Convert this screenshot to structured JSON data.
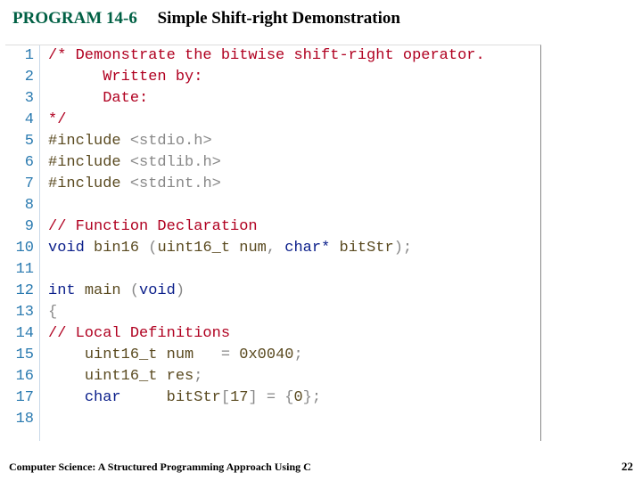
{
  "header": {
    "program_label": "PROGRAM 14-6",
    "title": "Simple Shift-right Demonstration"
  },
  "code": {
    "lines": [
      {
        "n": "1",
        "seg": [
          {
            "c": "comment",
            "t": "/* Demonstrate the bitwise shift-right operator."
          }
        ]
      },
      {
        "n": "2",
        "seg": [
          {
            "c": "comment",
            "t": "      Written by:"
          }
        ]
      },
      {
        "n": "3",
        "seg": [
          {
            "c": "comment",
            "t": "      Date:"
          }
        ]
      },
      {
        "n": "4",
        "seg": [
          {
            "c": "comment",
            "t": "*/"
          }
        ]
      },
      {
        "n": "5",
        "seg": [
          {
            "c": "pp",
            "t": "#include"
          },
          {
            "c": "",
            "t": " "
          },
          {
            "c": "angle",
            "t": "<stdio.h>"
          }
        ]
      },
      {
        "n": "6",
        "seg": [
          {
            "c": "pp",
            "t": "#include"
          },
          {
            "c": "",
            "t": " "
          },
          {
            "c": "angle",
            "t": "<stdlib.h>"
          }
        ]
      },
      {
        "n": "7",
        "seg": [
          {
            "c": "pp",
            "t": "#include"
          },
          {
            "c": "",
            "t": " "
          },
          {
            "c": "angle",
            "t": "<stdint.h>"
          }
        ]
      },
      {
        "n": "8",
        "seg": [
          {
            "c": "",
            "t": ""
          }
        ]
      },
      {
        "n": "9",
        "seg": [
          {
            "c": "comment",
            "t": "// Function Declaration"
          }
        ]
      },
      {
        "n": "10",
        "seg": [
          {
            "c": "key",
            "t": "void"
          },
          {
            "c": "",
            "t": " "
          },
          {
            "c": "id",
            "t": "bin16"
          },
          {
            "c": "",
            "t": " "
          },
          {
            "c": "punc",
            "t": "("
          },
          {
            "c": "id",
            "t": "uint16_t"
          },
          {
            "c": "",
            "t": " "
          },
          {
            "c": "id",
            "t": "num"
          },
          {
            "c": "punc",
            "t": ","
          },
          {
            "c": "",
            "t": " "
          },
          {
            "c": "key",
            "t": "char*"
          },
          {
            "c": "",
            "t": " "
          },
          {
            "c": "id",
            "t": "bitStr"
          },
          {
            "c": "punc",
            "t": ");"
          }
        ]
      },
      {
        "n": "11",
        "seg": [
          {
            "c": "",
            "t": ""
          }
        ]
      },
      {
        "n": "12",
        "seg": [
          {
            "c": "key",
            "t": "int"
          },
          {
            "c": "",
            "t": " "
          },
          {
            "c": "id",
            "t": "main"
          },
          {
            "c": "",
            "t": " "
          },
          {
            "c": "punc",
            "t": "("
          },
          {
            "c": "key",
            "t": "void"
          },
          {
            "c": "punc",
            "t": ")"
          }
        ]
      },
      {
        "n": "13",
        "seg": [
          {
            "c": "punc",
            "t": "{"
          }
        ]
      },
      {
        "n": "14",
        "seg": [
          {
            "c": "comment",
            "t": "// Local Definitions"
          }
        ]
      },
      {
        "n": "15",
        "seg": [
          {
            "c": "",
            "t": "    "
          },
          {
            "c": "id",
            "t": "uint16_t"
          },
          {
            "c": "",
            "t": " "
          },
          {
            "c": "id",
            "t": "num"
          },
          {
            "c": "",
            "t": "   "
          },
          {
            "c": "punc",
            "t": "="
          },
          {
            "c": "",
            "t": " "
          },
          {
            "c": "num",
            "t": "0x0040"
          },
          {
            "c": "punc",
            "t": ";"
          }
        ]
      },
      {
        "n": "16",
        "seg": [
          {
            "c": "",
            "t": "    "
          },
          {
            "c": "id",
            "t": "uint16_t"
          },
          {
            "c": "",
            "t": " "
          },
          {
            "c": "id",
            "t": "res"
          },
          {
            "c": "punc",
            "t": ";"
          }
        ]
      },
      {
        "n": "17",
        "seg": [
          {
            "c": "",
            "t": "    "
          },
          {
            "c": "key",
            "t": "char"
          },
          {
            "c": "",
            "t": "     "
          },
          {
            "c": "id",
            "t": "bitStr"
          },
          {
            "c": "punc",
            "t": "["
          },
          {
            "c": "num",
            "t": "17"
          },
          {
            "c": "punc",
            "t": "]"
          },
          {
            "c": "",
            "t": " "
          },
          {
            "c": "punc",
            "t": "="
          },
          {
            "c": "",
            "t": " "
          },
          {
            "c": "punc",
            "t": "{"
          },
          {
            "c": "num",
            "t": "0"
          },
          {
            "c": "punc",
            "t": "};"
          }
        ]
      },
      {
        "n": "18",
        "seg": [
          {
            "c": "",
            "t": ""
          }
        ]
      }
    ]
  },
  "footer": {
    "text": "Computer Science: A Structured Programming Approach Using C",
    "page": "22"
  }
}
